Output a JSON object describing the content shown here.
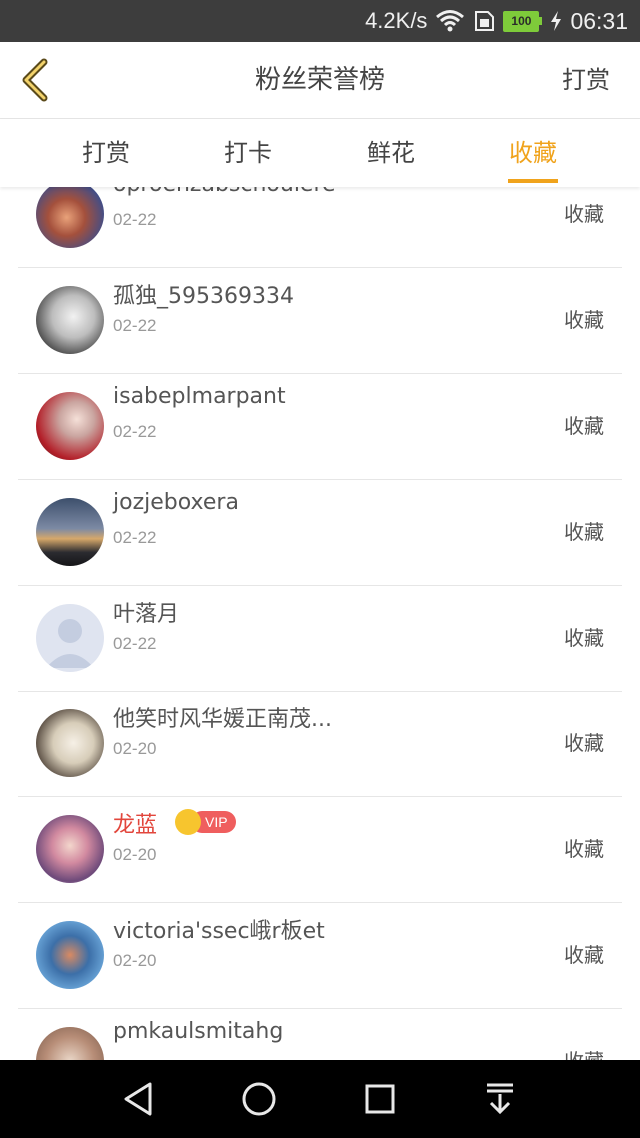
{
  "status_bar": {
    "speed": "4.2K/s",
    "battery": "100",
    "time": "06:31"
  },
  "header": {
    "title": "粉丝荣誉榜",
    "action": "打赏"
  },
  "tabs": [
    {
      "label": "打赏",
      "active": false
    },
    {
      "label": "打卡",
      "active": false
    },
    {
      "label": "鲜花",
      "active": false
    },
    {
      "label": "收藏",
      "active": true
    }
  ],
  "list": [
    {
      "name": "oproenzabschoulere",
      "date": "02-22",
      "action": "收藏",
      "vip": false
    },
    {
      "name": "孤独_595369334",
      "date": "02-22",
      "action": "收藏",
      "vip": false
    },
    {
      "name": "isabeplmarpant",
      "date": "02-22",
      "action": "收藏",
      "vip": false
    },
    {
      "name": "jozjeboxera",
      "date": "02-22",
      "action": "收藏",
      "vip": false
    },
    {
      "name": "叶落月",
      "date": "02-22",
      "action": "收藏",
      "vip": false
    },
    {
      "name": "他笑时风华媛正南茂...",
      "date": "02-20",
      "action": "收藏",
      "vip": false
    },
    {
      "name": "龙蓝",
      "date": "02-20",
      "action": "收藏",
      "vip": true,
      "vip_label": "VIP"
    },
    {
      "name": "victoria'ssec峨r板et",
      "date": "02-20",
      "action": "收藏",
      "vip": false
    },
    {
      "name": "pmkaulsmitahg",
      "date": "",
      "action": "收藏",
      "vip": false
    }
  ],
  "colors": {
    "accent": "#f0a31c",
    "vip_name": "#e2463c",
    "status_bar": "#3d3d3d"
  },
  "icons": {
    "back": "chevron-left-icon",
    "nav": [
      "back-triangle-icon",
      "home-circle-icon",
      "recents-square-icon",
      "notification-pull-icon"
    ]
  }
}
